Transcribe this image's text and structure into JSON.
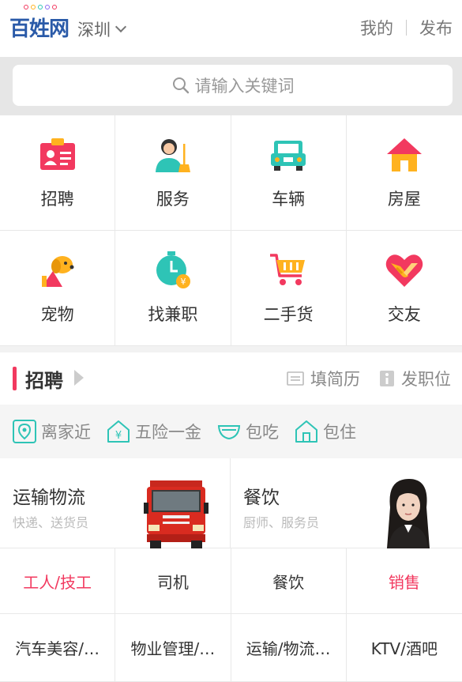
{
  "header": {
    "logo_text": "百姓网",
    "city": "深圳",
    "my_label": "我的",
    "publish_label": "发布"
  },
  "search": {
    "placeholder": "请输入关键词"
  },
  "categories": [
    {
      "label": "招聘",
      "icon": "id-card-icon"
    },
    {
      "label": "服务",
      "icon": "cleaner-icon"
    },
    {
      "label": "车辆",
      "icon": "car-icon"
    },
    {
      "label": "房屋",
      "icon": "house-icon"
    },
    {
      "label": "宠物",
      "icon": "dog-icon"
    },
    {
      "label": "找兼职",
      "icon": "clock-coin-icon"
    },
    {
      "label": "二手货",
      "icon": "cart-icon"
    },
    {
      "label": "交友",
      "icon": "heart-handshake-icon"
    }
  ],
  "recruit": {
    "title": "招聘",
    "resume_label": "填简历",
    "post_label": "发职位",
    "tags": [
      "离家近",
      "五险一金",
      "包吃",
      "包住"
    ],
    "features": [
      {
        "title": "运输物流",
        "subtitle": "快递、送货员"
      },
      {
        "title": "餐饮",
        "subtitle": "厨师、服务员"
      }
    ],
    "jobs": [
      {
        "label": "工人/技工",
        "hot": true
      },
      {
        "label": "司机",
        "hot": false
      },
      {
        "label": "餐饮",
        "hot": false
      },
      {
        "label": "销售",
        "hot": true
      },
      {
        "label": "汽车美容/…",
        "hot": false
      },
      {
        "label": "物业管理/…",
        "hot": false
      },
      {
        "label": "运输/物流…",
        "hot": false
      },
      {
        "label": "KTV/酒吧",
        "hot": false
      }
    ]
  },
  "colors": {
    "accent": "#f2395f",
    "brand": "#2a5aa8",
    "teal": "#2ec4b6",
    "yellow": "#ffb21f"
  }
}
